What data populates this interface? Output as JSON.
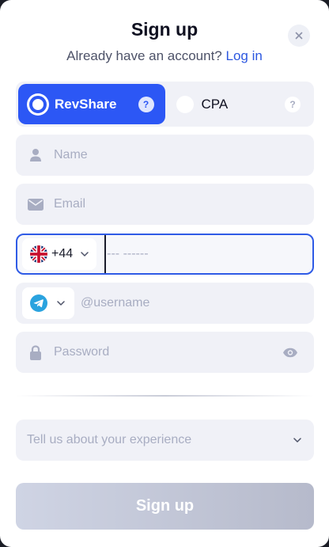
{
  "header": {
    "title": "Sign up",
    "subtitle_text": "Already have an account?",
    "login_link": "Log in",
    "close_symbol": "×"
  },
  "program": {
    "options": [
      {
        "label": "RevShare",
        "selected": true,
        "help": "?"
      },
      {
        "label": "CPA",
        "selected": false,
        "help": "?"
      }
    ]
  },
  "form": {
    "name": {
      "value": "",
      "placeholder": "Name",
      "icon": "user-icon"
    },
    "email": {
      "value": "",
      "placeholder": "Email",
      "icon": "envelope-icon"
    },
    "phone": {
      "country_code": "+44",
      "country_flag": "uk-flag-icon",
      "value": "",
      "placeholder": "--- ------"
    },
    "telegram": {
      "value": "",
      "placeholder": "@username",
      "icon": "telegram-icon"
    },
    "password": {
      "value": "",
      "placeholder": "Password",
      "icon": "lock-icon"
    },
    "experience": {
      "placeholder": "Tell us about your experience"
    }
  },
  "submit": {
    "label": "Sign up"
  },
  "colors": {
    "accent": "#2c57f5",
    "link": "#2c57e0",
    "field_bg": "#f0f1f7",
    "placeholder": "#a8adc2",
    "button_disabled": "#c5c9d9"
  }
}
